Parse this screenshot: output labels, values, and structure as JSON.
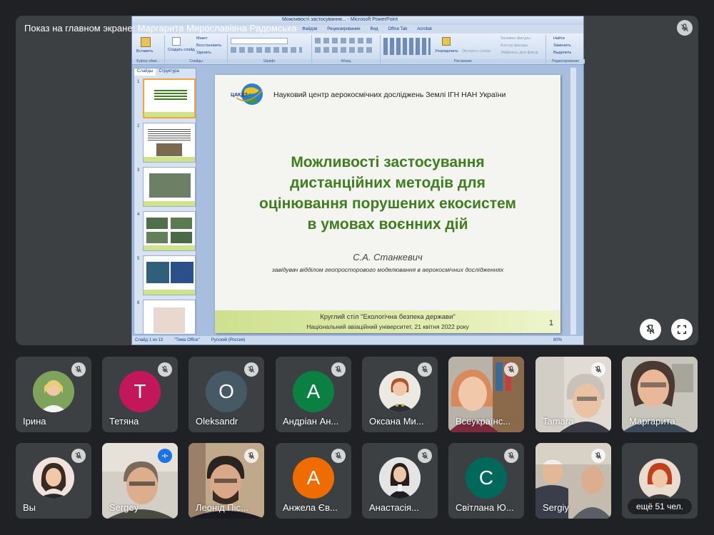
{
  "stage": {
    "title": "Показ на главном экране: Маргарита Мирославівна Радомська"
  },
  "ppt": {
    "window_title": "Можливості застосування... - Microsoft PowerPoint",
    "tabs": [
      "Файдов",
      "Рецензирование",
      "Вид",
      "Office Tab",
      "Acrobat"
    ],
    "ribbon": {
      "paste": "Вставить",
      "new_slide": "Создать слайд",
      "layout": "Макет",
      "reset": "Восстановить",
      "delete": "Удалить",
      "arrange": "Упорядочить",
      "quick_styles": "Экспресс-стили",
      "shape_fill": "Заливка фигуры",
      "shape_outline": "Контур фигуры",
      "shape_effects": "Эффекты для фигур",
      "find": "Найти",
      "replace": "Заменить",
      "select": "Выделить",
      "group_clipboard": "Буфер обме...",
      "group_slides": "Слайды",
      "group_font": "Шрифт",
      "group_paragraph": "Абзац",
      "group_drawing": "Рисование",
      "group_editing": "Редактирование"
    },
    "thumb_tabs": [
      "Слайды",
      "Структура"
    ],
    "thumbs": [
      "1",
      "2",
      "3",
      "4",
      "5",
      "6"
    ],
    "status": {
      "slide": "Слайд 1 из 13",
      "theme": "\"Тема Office\"",
      "lang": "Русский (Россия)",
      "zoom": "80%"
    }
  },
  "slide": {
    "logo_text": "ЦАКДЗ",
    "org": "Науковий центр аерокосмічних досліджень Землі ІГН НАН України",
    "title_lines": [
      "Можливості застосування",
      "дистанційних методів для",
      "оцінювання порушених екосистем",
      "в умовах воєнних дій"
    ],
    "author": "С.А. Станкевич",
    "position": "завідувач відділом геопросторового моделювання в аерокосмічних дослідженнях",
    "footer_line1": "Круглий стіл \"Екологічна безпека держави\"",
    "footer_line2": "Національний авіаційний університет, 21 квітня 2022 року",
    "page": "1"
  },
  "participants": [
    {
      "name": "Ірина"
    },
    {
      "name": "Тетяна",
      "initial": "Т"
    },
    {
      "name": "Oleksandr",
      "initial": "O"
    },
    {
      "name": "Андріан Ан..."
    },
    {
      "name": "Оксана Ми..."
    },
    {
      "name": "Всеукраїнс..."
    },
    {
      "name": "Tamara"
    },
    {
      "name": "Маргарита..."
    },
    {
      "name": "Вы"
    },
    {
      "name": "Sergey"
    },
    {
      "name": "Леонід Піс..."
    },
    {
      "name": "Анжела Єв..."
    },
    {
      "name": "Анастасія..."
    },
    {
      "name": "Світлана Ю..."
    },
    {
      "name": "Sergiy"
    },
    {
      "name": "ещё 51 чел."
    }
  ],
  "initials": {
    "andrian": "А",
    "angela": "А",
    "svitlana": "С"
  },
  "colors": {
    "background": "#202124",
    "tile": "#3c4043",
    "slide_title": "#3f7e1f",
    "avatar_tetiana": "#c2185b",
    "avatar_oleksandr": "#455a64",
    "avatar_andrian": "#0b8043",
    "avatar_angela": "#ef6c00",
    "avatar_svitlana": "#00695c",
    "active_mic": "#1a73e8"
  }
}
